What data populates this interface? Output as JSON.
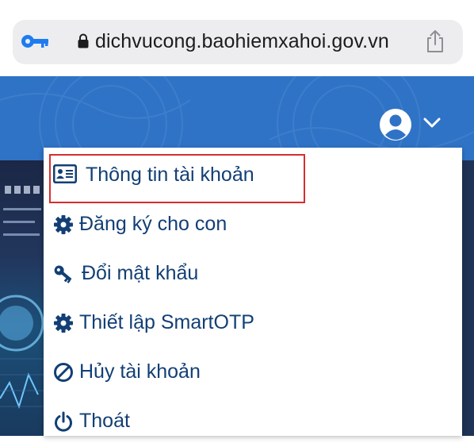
{
  "browser": {
    "url": "dichvucong.baohiemxahoi.gov.vn",
    "icons": {
      "passwords": "key-icon",
      "secure": "lock-icon",
      "share": "share-icon"
    }
  },
  "header": {
    "user_icon": "user-circle-icon",
    "dropdown_icon": "chevron-down-icon",
    "accent_color": "#2f73c6"
  },
  "menu": {
    "text_color": "#123f75",
    "highlight_color": "#d62e2e",
    "items": [
      {
        "label": "Thông tin tài khoản",
        "icon": "id-card-icon",
        "highlighted": true
      },
      {
        "label": "Đăng ký cho con",
        "icon": "gear-icon"
      },
      {
        "label": "Đổi mật khẩu",
        "icon": "key-icon"
      },
      {
        "label": "Thiết lập SmartOTP",
        "icon": "gear-icon"
      },
      {
        "label": "Hủy tài khoản",
        "icon": "ban-icon"
      },
      {
        "label": "Thoát",
        "icon": "power-icon"
      }
    ]
  }
}
